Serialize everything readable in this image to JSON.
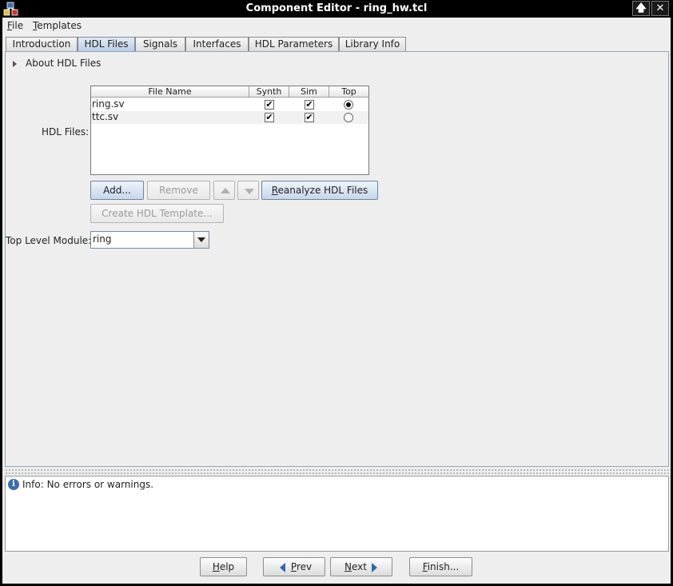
{
  "window": {
    "title": "Component Editor - ring_hw.tcl",
    "controls": {
      "maximize": "🡅",
      "close": "✕"
    }
  },
  "menu": {
    "file": {
      "mnemonic": "F",
      "rest": "ile"
    },
    "templates": {
      "mnemonic": "T",
      "rest": "emplates"
    }
  },
  "tabs": [
    {
      "label": "Introduction"
    },
    {
      "label": "HDL Files",
      "active": true
    },
    {
      "label": "Signals"
    },
    {
      "label": "Interfaces"
    },
    {
      "label": "HDL Parameters"
    },
    {
      "label": "Library Info"
    }
  ],
  "hdl": {
    "about_label": "About HDL Files",
    "files_label": "HDL Files:",
    "table": {
      "columns": [
        "File Name",
        "Synth",
        "Sim",
        "Top"
      ],
      "rows": [
        {
          "name": "ring.sv",
          "synth": "✔",
          "sim": "✔",
          "top": true
        },
        {
          "name": "ttc.sv",
          "synth": "✔",
          "sim": "✔",
          "top": false
        }
      ]
    },
    "buttons": {
      "add": "Add...",
      "remove": "Remove",
      "reanalyze_mnemonic": "R",
      "reanalyze_rest": "eanalyze HDL Files",
      "create_template": "Create HDL Template..."
    },
    "top_level_label": "Top Level Module:",
    "top_level_value": "ring"
  },
  "info": {
    "icon": "i",
    "message": "Info: No errors or warnings."
  },
  "footer": {
    "help": {
      "mnemonic": "H",
      "rest": "elp"
    },
    "prev": {
      "mnemonic": "P",
      "rest": "rev"
    },
    "next": {
      "mnemonic": "N",
      "rest": "ext"
    },
    "finish": {
      "mnemonic": "F",
      "rest": "inish..."
    }
  },
  "colors": {
    "active_tab": "#b9cde5",
    "info_icon": "#3a6fb0",
    "nav_arrow": "#2f66b0"
  }
}
